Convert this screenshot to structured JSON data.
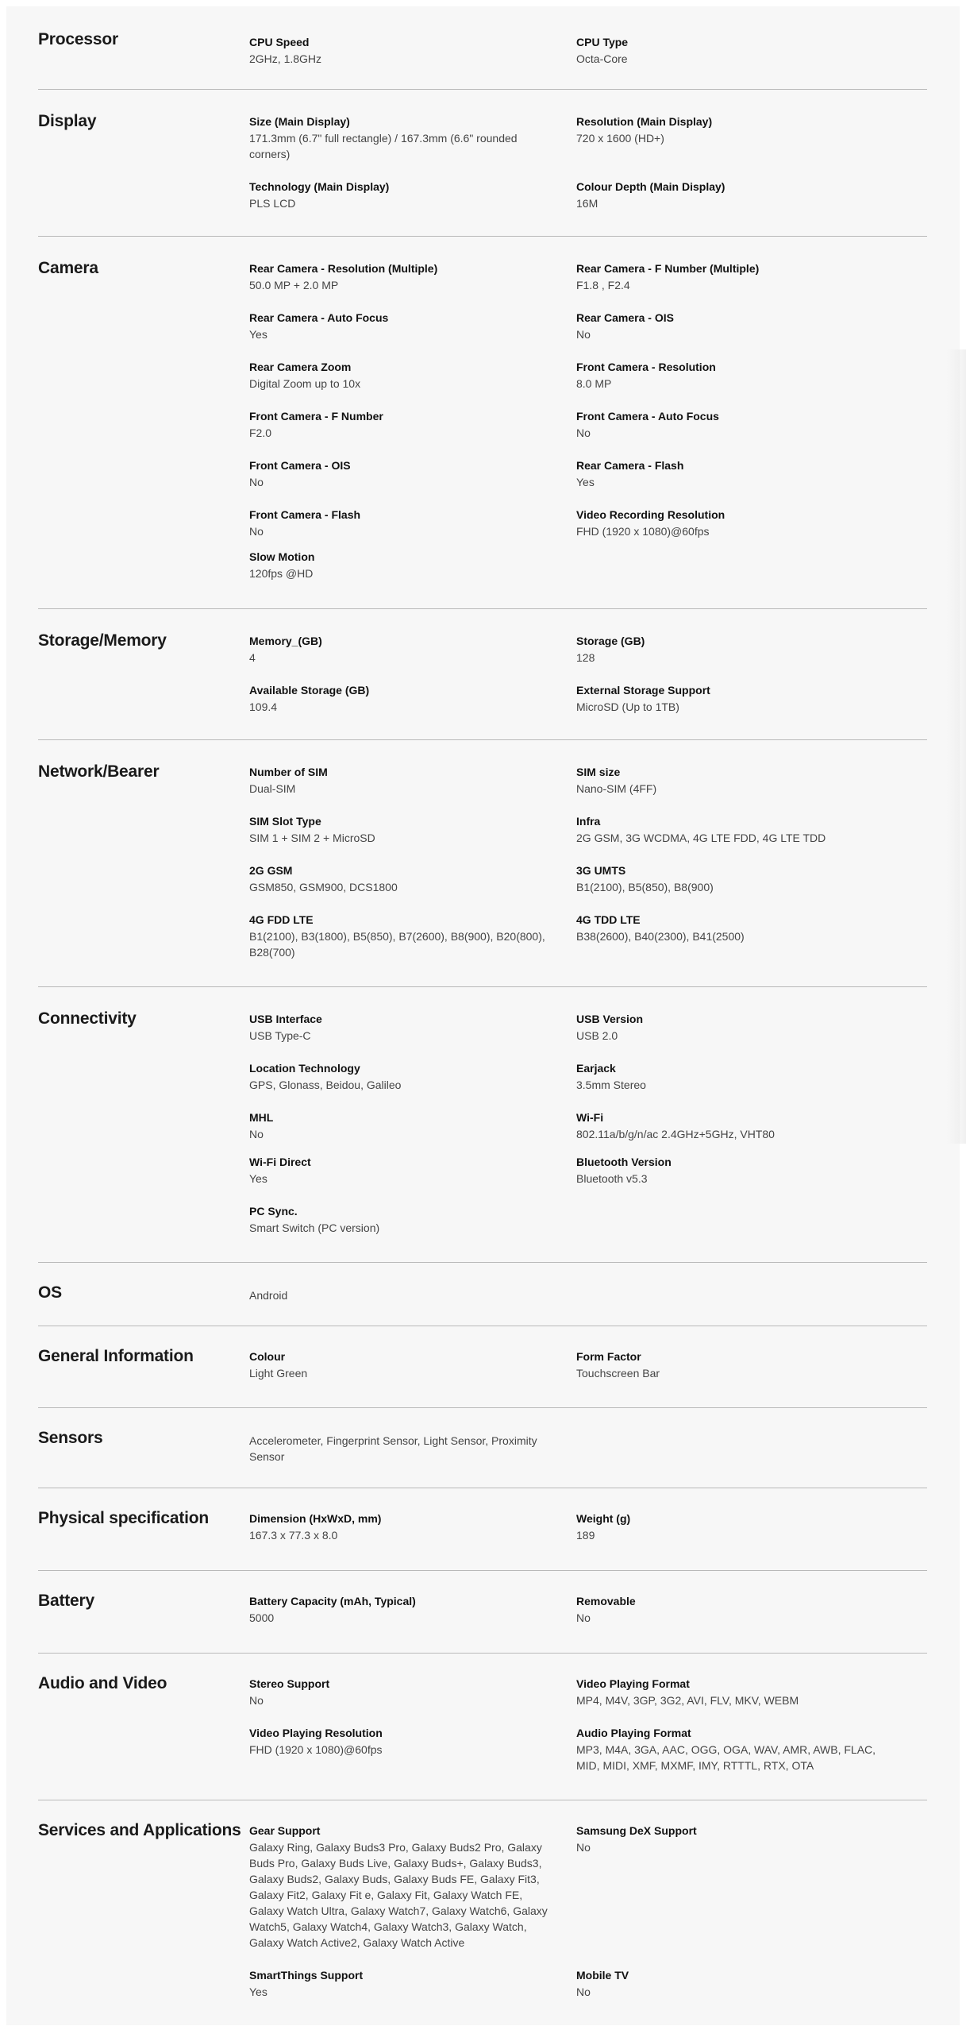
{
  "sections": [
    {
      "title": "Processor",
      "fields": [
        {
          "label": "CPU Speed",
          "value": "2GHz, 1.8GHz"
        },
        {
          "label": "CPU Type",
          "value": "Octa-Core"
        }
      ]
    },
    {
      "title": "Display",
      "fields": [
        {
          "label": "Size (Main Display)",
          "value": "171.3mm (6.7\" full rectangle) / 167.3mm (6.6\" rounded corners)"
        },
        {
          "label": "Resolution (Main Display)",
          "value": "720 x 1600 (HD+)"
        },
        {
          "label": "Technology (Main Display)",
          "value": "PLS LCD"
        },
        {
          "label": "Colour Depth (Main Display)",
          "value": "16M"
        }
      ]
    },
    {
      "title": "Camera",
      "fields": [
        {
          "label": "Rear Camera - Resolution (Multiple)",
          "value": "50.0 MP + 2.0 MP"
        },
        {
          "label": "Rear Camera - F Number (Multiple)",
          "value": "F1.8 , F2.4"
        },
        {
          "label": "Rear Camera - Auto Focus",
          "value": "Yes"
        },
        {
          "label": "Rear Camera - OIS",
          "value": "No"
        },
        {
          "label": "Rear Camera Zoom",
          "value": "Digital Zoom up to 10x"
        },
        {
          "label": "Front Camera - Resolution",
          "value": "8.0 MP"
        },
        {
          "label": "Front Camera - F Number",
          "value": "F2.0"
        },
        {
          "label": "Front Camera - Auto Focus",
          "value": "No"
        },
        {
          "label": "Front Camera - OIS",
          "value": "No"
        },
        {
          "label": "Rear Camera - Flash",
          "value": "Yes"
        },
        {
          "label": "Front Camera - Flash",
          "value": "No"
        },
        {
          "label": "Video Recording Resolution",
          "value": "FHD (1920 x 1080)@60fps"
        },
        {
          "label": "Slow Motion",
          "value": "120fps @HD"
        }
      ]
    },
    {
      "title": "Storage/Memory",
      "fields": [
        {
          "label": "Memory_(GB)",
          "value": "4"
        },
        {
          "label": "Storage (GB)",
          "value": "128"
        },
        {
          "label": "Available Storage (GB)",
          "value": "109.4"
        },
        {
          "label": "External Storage Support",
          "value": "MicroSD (Up to 1TB)"
        }
      ]
    },
    {
      "title": "Network/Bearer",
      "fields": [
        {
          "label": "Number of SIM",
          "value": "Dual-SIM"
        },
        {
          "label": "SIM size",
          "value": "Nano-SIM (4FF)"
        },
        {
          "label": "SIM Slot Type",
          "value": "SIM 1 + SIM 2 + MicroSD"
        },
        {
          "label": "Infra",
          "value": "2G GSM, 3G WCDMA, 4G LTE FDD, 4G LTE TDD"
        },
        {
          "label": "2G GSM",
          "value": "GSM850, GSM900, DCS1800"
        },
        {
          "label": "3G UMTS",
          "value": "B1(2100), B5(850), B8(900)"
        },
        {
          "label": "4G FDD LTE",
          "value": "B1(2100), B3(1800), B5(850), B7(2600), B8(900), B20(800), B28(700)"
        },
        {
          "label": "4G TDD LTE",
          "value": "B38(2600), B40(2300), B41(2500)"
        }
      ]
    },
    {
      "title": "Connectivity",
      "fields": [
        {
          "label": "USB Interface",
          "value": "USB Type-C"
        },
        {
          "label": "USB Version",
          "value": "USB 2.0"
        },
        {
          "label": "Location Technology",
          "value": "GPS, Glonass, Beidou, Galileo"
        },
        {
          "label": "Earjack",
          "value": "3.5mm Stereo"
        },
        {
          "label": "MHL",
          "value": "No"
        },
        {
          "label": "Wi-Fi",
          "value": "802.11a/b/g/n/ac 2.4GHz+5GHz, VHT80"
        },
        {
          "label": "Wi-Fi Direct",
          "value": "Yes"
        },
        {
          "label": "Bluetooth Version",
          "value": "Bluetooth v5.3"
        },
        {
          "label": "PC Sync.",
          "value": "Smart Switch (PC version)"
        }
      ]
    },
    {
      "title": "OS",
      "value": "Android"
    },
    {
      "title": "General Information",
      "fields": [
        {
          "label": "Colour",
          "value": "Light Green"
        },
        {
          "label": "Form Factor",
          "value": "Touchscreen Bar"
        }
      ]
    },
    {
      "title": "Sensors",
      "value": "Accelerometer, Fingerprint Sensor, Light Sensor, Proximity Sensor"
    },
    {
      "title": "Physical specification",
      "fields": [
        {
          "label": "Dimension (HxWxD, mm)",
          "value": "167.3 x 77.3 x 8.0"
        },
        {
          "label": "Weight (g)",
          "value": "189"
        }
      ]
    },
    {
      "title": "Battery",
      "fields": [
        {
          "label": "Battery Capacity (mAh, Typical)",
          "value": "5000"
        },
        {
          "label": "Removable",
          "value": "No"
        }
      ]
    },
    {
      "title": "Audio and Video",
      "fields": [
        {
          "label": "Stereo Support",
          "value": "No"
        },
        {
          "label": "Video Playing Format",
          "value": "MP4, M4V, 3GP, 3G2, AVI, FLV, MKV, WEBM"
        },
        {
          "label": "Video Playing Resolution",
          "value": "FHD (1920 x 1080)@60fps"
        },
        {
          "label": "Audio Playing Format",
          "value": "MP3, M4A, 3GA, AAC, OGG, OGA, WAV, AMR, AWB, FLAC, MID, MIDI, XMF, MXMF, IMY, RTTTL, RTX, OTA"
        }
      ]
    },
    {
      "title": "Services and Applications",
      "fields": [
        {
          "label": "Gear Support",
          "value": "Galaxy Ring, Galaxy Buds3 Pro, Galaxy Buds2 Pro, Galaxy Buds Pro, Galaxy Buds Live, Galaxy Buds+, Galaxy Buds3, Galaxy Buds2, Galaxy Buds, Galaxy Buds FE, Galaxy Fit3, Galaxy Fit2, Galaxy Fit e, Galaxy Fit, Galaxy Watch FE, Galaxy Watch Ultra, Galaxy Watch7, Galaxy Watch6, Galaxy Watch5, Galaxy Watch4, Galaxy Watch3, Galaxy Watch, Galaxy Watch Active2, Galaxy Watch Active"
        },
        {
          "label": "Samsung DeX Support",
          "value": "No"
        },
        {
          "label": "SmartThings Support",
          "value": "Yes"
        },
        {
          "label": "Mobile TV",
          "value": "No"
        }
      ]
    }
  ]
}
